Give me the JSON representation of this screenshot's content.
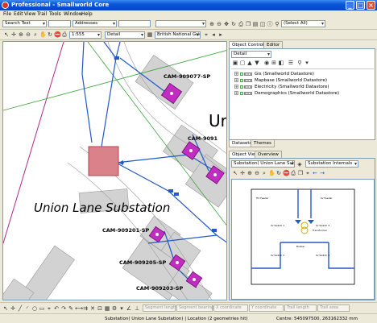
{
  "window": {
    "title": "Professional - Smallworld Core",
    "minimize": "_",
    "maximize": "□",
    "close": "×"
  },
  "menu": [
    "File",
    "Edit",
    "View",
    "Trail",
    "Tools",
    "Window",
    "Help"
  ],
  "toolbar1": {
    "search_type": "Search Text",
    "address_type": "Addresses",
    "world_select": "",
    "selection_filter": "(Select All)"
  },
  "toolbar2": {
    "scale": "1:555",
    "detail": "Detail",
    "grid": "British National Grid"
  },
  "map": {
    "labels": {
      "union_lane": "Union Lane Substation",
      "cam_077": "CAM-909077-SP",
      "cam_091": "CAM-9091",
      "cam_201": "CAM-909201-SP",
      "cam_205": "CAM-909205-SP",
      "cam_203": "CAM-909203-SP",
      "ur": "Ur"
    }
  },
  "object_control": {
    "tabs": [
      "Object Control",
      "Editor"
    ],
    "detail": "Detail",
    "layers": [
      "Gis (Smallworld Datastore)",
      "Mapbase (Smallworld Datastore)",
      "Electricity (Smallworld Datastore)",
      "Demographics (Smallworld Datastore)"
    ],
    "bottom_tabs": [
      "Datasets",
      "Themes"
    ]
  },
  "object_view": {
    "tabs": [
      "Object View",
      "Overview"
    ],
    "object_select": "Substation( Union Lane Substa",
    "view_select": "Substation Internals"
  },
  "schematic": {
    "labels": [
      "LV Switch 1",
      "LV Switch 2",
      "LV Switch 3",
      "LV Switch 4",
      "Transformer",
      "HV Feeder",
      "LV Feeder",
      "Busbar"
    ]
  },
  "statusbar": {
    "fields": [
      "Segment length",
      "Segment bearing",
      "X coordinate",
      "Y coordinate",
      "Trail length",
      "Trail area"
    ],
    "selection_text": "Substation( Union Lane Substation) | Location (2 geometries hit)",
    "centre_text": "Centre: 545097500, 263162332 mm"
  }
}
